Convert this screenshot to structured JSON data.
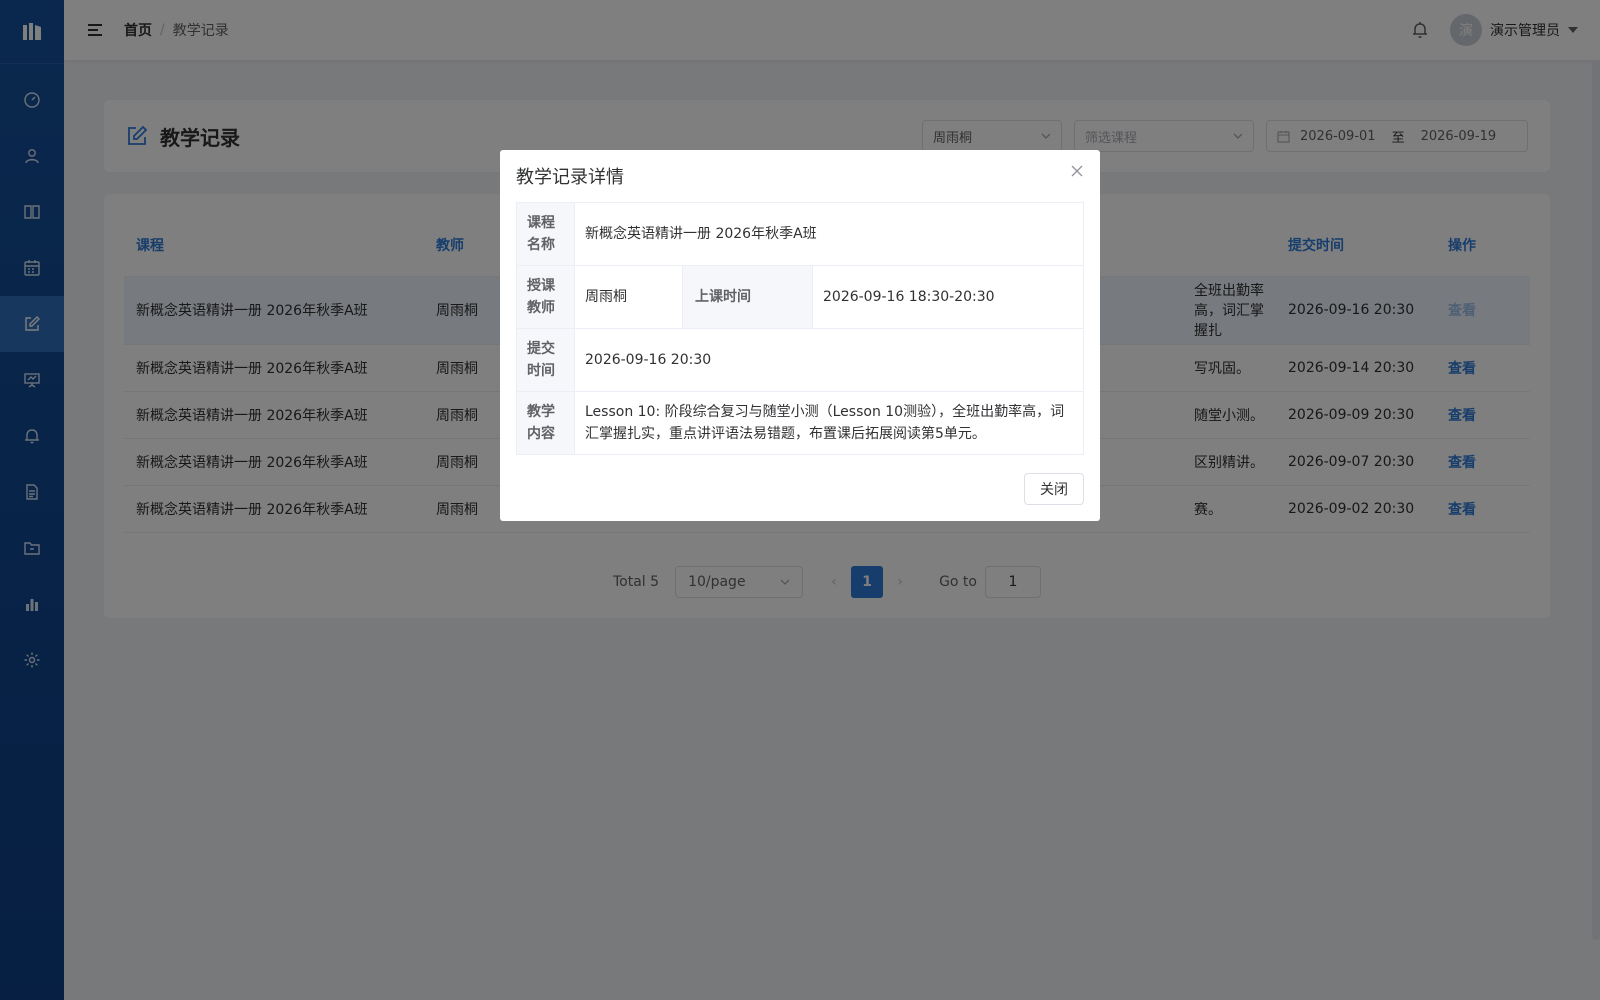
{
  "breadcrumb": {
    "home": "首页",
    "separator": "/",
    "current": "教学记录"
  },
  "user": {
    "avatar_text": "演",
    "name": "演示管理员"
  },
  "page": {
    "title": "教学记录"
  },
  "filters": {
    "teacher": "周雨桐",
    "course_placeholder": "筛选课程",
    "date_start": "2026-09-01",
    "date_to": "至",
    "date_end": "2026-09-19"
  },
  "table": {
    "columns": {
      "course": "课程",
      "teacher": "教师",
      "submit_time": "提交时间",
      "action": "操作"
    },
    "rows": [
      {
        "course": "新概念英语精讲一册 2026年秋季A班",
        "teacher": "周雨桐",
        "content_tail": "全班出勤率高，词汇掌握扎",
        "submit_time": "2026-09-16 20:30",
        "action": "查看"
      },
      {
        "course": "新概念英语精讲一册 2026年秋季A班",
        "teacher": "周雨桐",
        "content_tail": "写巩固。",
        "submit_time": "2026-09-14 20:30",
        "action": "查看"
      },
      {
        "course": "新概念英语精讲一册 2026年秋季A班",
        "teacher": "周雨桐",
        "content_tail": "随堂小测。",
        "submit_time": "2026-09-09 20:30",
        "action": "查看"
      },
      {
        "course": "新概念英语精讲一册 2026年秋季A班",
        "teacher": "周雨桐",
        "content_tail": "区别精讲。",
        "submit_time": "2026-09-07 20:30",
        "action": "查看"
      },
      {
        "course": "新概念英语精讲一册 2026年秋季A班",
        "teacher": "周雨桐",
        "content_tail": "赛。",
        "submit_time": "2026-09-02 20:30",
        "action": "查看"
      }
    ]
  },
  "pagination": {
    "total": "Total 5",
    "page_size": "10/page",
    "current": "1",
    "goto_label": "Go to",
    "goto_value": "1"
  },
  "modal": {
    "title": "教学记录详情",
    "course_label": "课程名称",
    "course_value": "新概念英语精讲一册 2026年秋季A班",
    "teacher_label": "授课教师",
    "teacher_value": "周雨桐",
    "class_time_label": "上课时间",
    "class_time_value": "2026-09-16 18:30-20:30",
    "submit_label": "提交时间",
    "submit_value": "2026-09-16 20:30",
    "content_label": "教学内容",
    "content_value": "Lesson 10: 阶段综合复习与随堂小测（Lesson 10测验），全班出勤率高，词汇掌握扎实，重点讲评语法易错题，布置课后拓展阅读第5单元。",
    "close_button": "关闭"
  },
  "colors": {
    "sidebar": "#15509b",
    "accent": "#2f7bd8",
    "active_nav": "#2f6fbf"
  }
}
